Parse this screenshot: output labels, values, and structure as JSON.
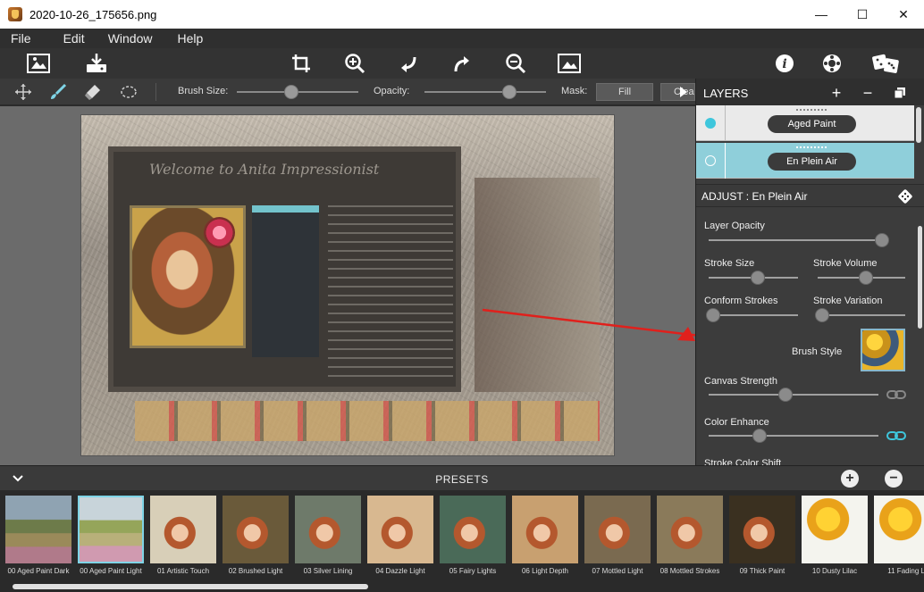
{
  "window": {
    "title": "2020-10-26_175656.png",
    "minimize": "—",
    "maximize": "☐",
    "close": "✕"
  },
  "menu": [
    "File",
    "Edit",
    "Window",
    "Help"
  ],
  "toolbar": {
    "icons": [
      "open-image-icon",
      "save-icon",
      "crop-icon",
      "zoom-in-icon",
      "undo-icon",
      "redo-icon",
      "zoom-out-icon",
      "fit-image-icon",
      "info-icon",
      "settings-icon",
      "randomize-dice-icon"
    ]
  },
  "brushbar": {
    "brush_size_label": "Brush Size:",
    "brush_size": 0.45,
    "opacity_label": "Opacity:",
    "opacity": 0.7,
    "mask_label": "Mask:",
    "fill_label": "Fill",
    "clear_label": "Clea"
  },
  "layers": {
    "title": "LAYERS",
    "add": "+",
    "remove": "−",
    "items": [
      {
        "name": "Aged Paint",
        "active": false
      },
      {
        "name": "En Plein Air",
        "active": true
      }
    ]
  },
  "adjust": {
    "title": "ADJUST : En Plein Air",
    "layer_opacity": {
      "label": "Layer Opacity",
      "value": 0.98
    },
    "stroke_size": {
      "label": "Stroke Size",
      "value": 0.55
    },
    "stroke_volume": {
      "label": "Stroke Volume",
      "value": 0.55
    },
    "conform_strokes": {
      "label": "Conform Strokes",
      "value": 0.05
    },
    "stroke_variation": {
      "label": "Stroke Variation",
      "value": 0.05
    },
    "brush_style_label": "Brush Style",
    "canvas_strength": {
      "label": "Canvas Strength",
      "value": 0.45
    },
    "color_enhance": {
      "label": "Color Enhance",
      "value": 0.3
    },
    "stroke_color_shift_label": "Stroke Color Shift"
  },
  "presets": {
    "title": "PRESETS",
    "items": [
      {
        "label": "00 Aged Paint Dark",
        "selected": false
      },
      {
        "label": "00 Aged Paint Light",
        "selected": true
      },
      {
        "label": "01 Artistic Touch",
        "selected": false
      },
      {
        "label": "02 Brushed Light",
        "selected": false
      },
      {
        "label": "03 Silver Lining",
        "selected": false
      },
      {
        "label": "04 Dazzle Light",
        "selected": false
      },
      {
        "label": "05 Fairy Lights",
        "selected": false
      },
      {
        "label": "06 Light Depth",
        "selected": false
      },
      {
        "label": "07 Mottled Light",
        "selected": false
      },
      {
        "label": "08 Mottled Strokes",
        "selected": false
      },
      {
        "label": "09 Thick Paint",
        "selected": false
      },
      {
        "label": "10 Dusty Lilac",
        "selected": false
      },
      {
        "label": "11 Fading Li",
        "selected": false
      }
    ]
  },
  "painting": {
    "heading": "Welcome to Anita Impressionist"
  }
}
